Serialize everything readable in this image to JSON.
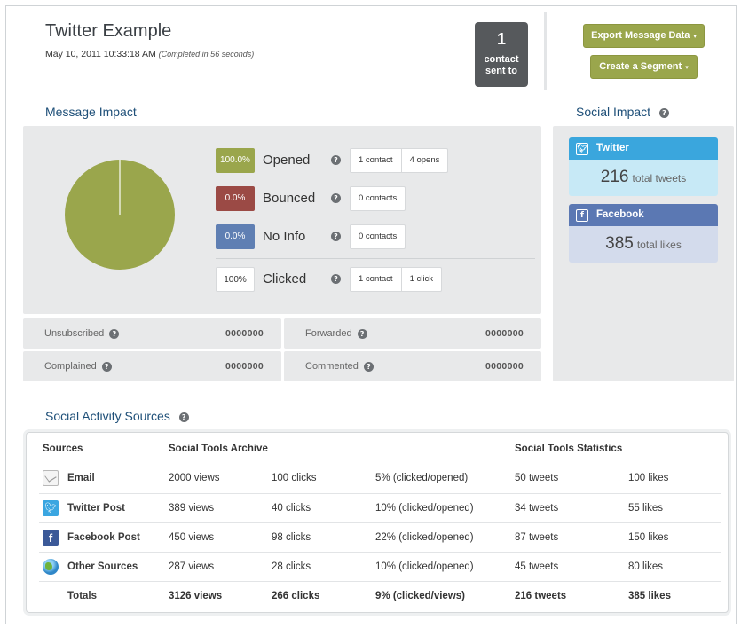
{
  "header": {
    "title": "Twitter Example",
    "timestamp": "May 10, 2011 10:33:18 AM",
    "completed_note": "(Completed in 56 seconds)",
    "sent_count": "1",
    "sent_label_line1": "contact",
    "sent_label_line2": "sent to",
    "export_label": "Export Message Data",
    "segment_label": "Create a Segment",
    "caret": "▾"
  },
  "message_impact": {
    "title": "Message Impact",
    "pie": {
      "opened_pct": 100.0
    },
    "metrics": [
      {
        "pct": "100.0%",
        "label": "Opened",
        "color": "#9aa64c",
        "pills": [
          "1 contact",
          "4 opens"
        ]
      },
      {
        "pct": "0.0%",
        "label": "Bounced",
        "color": "#9b4a45",
        "pills": [
          "0 contacts"
        ]
      },
      {
        "pct": "0.0%",
        "label": "No Info",
        "color": "#5f7fb3",
        "pills": [
          "0 contacts"
        ]
      },
      {
        "pct": "100%",
        "label": "Clicked",
        "color": "#ffffff",
        "pills": [
          "1 contact",
          "1 click"
        ]
      }
    ],
    "stats": [
      {
        "label": "Unsubscribed",
        "value": "0000000"
      },
      {
        "label": "Forwarded",
        "value": "0000000"
      },
      {
        "label": "Complained",
        "value": "0000000"
      },
      {
        "label": "Commented",
        "value": "0000000"
      }
    ]
  },
  "social_impact": {
    "title": "Social Impact",
    "twitter": {
      "name": "Twitter",
      "count": "216",
      "unit": "total tweets",
      "head_color": "#3aa6dd",
      "body_color": "#c7e9f6"
    },
    "facebook": {
      "name": "Facebook",
      "count": "385",
      "unit": "total likes",
      "head_color": "#5b78b3",
      "body_color": "#d3dbec"
    }
  },
  "sources": {
    "title": "Social Activity Sources",
    "headers": {
      "sources": "Sources",
      "archive": "Social Tools Archive",
      "statistics": "Social Tools Statistics"
    },
    "rows": [
      {
        "icon": "email-icon",
        "name": "Email",
        "views": "2000 views",
        "clicks": "100 clicks",
        "ratio": "5% (clicked/opened)",
        "tweets": "50 tweets",
        "likes": "100 likes"
      },
      {
        "icon": "twitter-icon",
        "name": "Twitter Post",
        "views": "389 views",
        "clicks": "40 clicks",
        "ratio": "10% (clicked/opened)",
        "tweets": "34 tweets",
        "likes": "55 likes"
      },
      {
        "icon": "facebook-icon",
        "name": "Facebook Post",
        "views": "450 views",
        "clicks": "98 clicks",
        "ratio": "22% (clicked/opened)",
        "tweets": "87 tweets",
        "likes": "150 likes"
      },
      {
        "icon": "globe-icon",
        "name": "Other Sources",
        "views": "287 views",
        "clicks": "28 clicks",
        "ratio": "10% (clicked/opened)",
        "tweets": "45 tweets",
        "likes": "80 likes"
      }
    ],
    "totals": {
      "name": "Totals",
      "views": "3126 views",
      "clicks": "266 clicks",
      "ratio": "9% (clicked/views)",
      "tweets": "216 tweets",
      "likes": "385 likes"
    }
  }
}
